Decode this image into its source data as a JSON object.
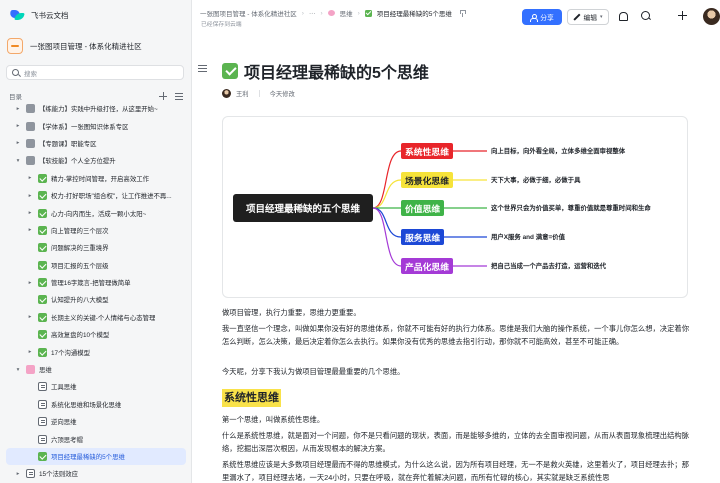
{
  "sidebar": {
    "brand": "飞书云文档",
    "workspace": "一张图项目管理 - 体系化精进社区",
    "search_placeholder": "搜索",
    "toc_title": "目录",
    "items": [
      {
        "arrow": "▸",
        "icon": "folder",
        "label": "【练能力】实践中升级打怪，从这里开始~",
        "indent": 1
      },
      {
        "arrow": "▸",
        "icon": "folder",
        "label": "【学体系】一张图知识体系专区",
        "indent": 1
      },
      {
        "arrow": "▸",
        "icon": "folder",
        "label": "【专题课】职能专区",
        "indent": 1
      },
      {
        "arrow": "▾",
        "icon": "folder",
        "label": "【软技能】个人全方位提升",
        "indent": 1
      },
      {
        "arrow": "▸",
        "icon": "check",
        "label": "精力-掌控时间管理，开启高效工作",
        "indent": 2
      },
      {
        "arrow": "▸",
        "icon": "check",
        "label": "权力-打好职场\"组合权\"，让工作推进不再...",
        "indent": 2
      },
      {
        "arrow": "▸",
        "icon": "check",
        "label": "心力-向内而生，活成一颗小太阳~",
        "indent": 2
      },
      {
        "arrow": "▸",
        "icon": "check",
        "label": "向上管理的三个层次",
        "indent": 2
      },
      {
        "arrow": "",
        "icon": "check",
        "label": "问题解决的三重境界",
        "indent": 2
      },
      {
        "arrow": "",
        "icon": "check",
        "label": "项目汇报的五个层级",
        "indent": 2
      },
      {
        "arrow": "▸",
        "icon": "check",
        "label": "管理16字箴言-把管理做简单",
        "indent": 2
      },
      {
        "arrow": "",
        "icon": "check",
        "label": "认知提升的八大模型",
        "indent": 2
      },
      {
        "arrow": "▸",
        "icon": "check",
        "label": "长期主义的关键-个人情绪与心态管理",
        "indent": 2
      },
      {
        "arrow": "",
        "icon": "check",
        "label": "高效复盘的10个模型",
        "indent": 2
      },
      {
        "arrow": "▸",
        "icon": "check",
        "label": "17个沟通模型",
        "indent": 2
      },
      {
        "arrow": "▾",
        "icon": "brain",
        "label": "思维",
        "indent": 1
      },
      {
        "arrow": "",
        "icon": "doc",
        "label": "工具思维",
        "indent": 2
      },
      {
        "arrow": "",
        "icon": "doc",
        "label": "系统化思维和场景化思维",
        "indent": 2
      },
      {
        "arrow": "",
        "icon": "doc",
        "label": "逆向思维",
        "indent": 2
      },
      {
        "arrow": "",
        "icon": "doc",
        "label": "六顶思考帽",
        "indent": 2
      },
      {
        "arrow": "",
        "icon": "check",
        "label": "项目经理最稀缺的5个思维",
        "indent": 2,
        "active": true
      },
      {
        "arrow": "▸",
        "icon": "doc",
        "label": "15个法则效应",
        "indent": 1
      }
    ]
  },
  "topbar": {
    "crumbs": [
      "一张图项目管理 - 体系化精进社区",
      "···",
      "思维",
      "项目经理最稀缺的5个思维"
    ],
    "saved": "已经保存到云端",
    "share_label": "分享",
    "edit_label": "编辑"
  },
  "doc": {
    "title": "项目经理最稀缺的5个思维",
    "author": "王利",
    "modified": "今天修改",
    "mindmap": {
      "root": "项目经理最稀缺的五个思维",
      "nodes": [
        {
          "label": "系统性思维",
          "desc": "向上目标，向外看全局，立体多维全面审视整体",
          "color": "#e8252a",
          "text": "#ffffff"
        },
        {
          "label": "场景化思维",
          "desc": "天下大事，必做于细，必做于具",
          "color": "#f6e33a",
          "text": "#1f2329"
        },
        {
          "label": "价值思维",
          "desc": "这个世界只会为价值买单，尊重价值就是尊重时间和生命",
          "color": "#3fb348",
          "text": "#ffffff"
        },
        {
          "label": "服务思维",
          "desc": "用户X服务 and 满意=价值",
          "color": "#1c48d6",
          "text": "#ffffff"
        },
        {
          "label": "产品化思维",
          "desc": "把自己当成一个产品去打造，运营和迭代",
          "color": "#a43ad6",
          "text": "#ffffff"
        }
      ]
    },
    "p1": "做项目管理，执行力重要，思维力更重要。",
    "p2": "我一直坚信一个理念，叫做如果你没有好的思维体系，你就不可能有好的执行力体系。思维是我们大脑的操作系统，一个事儿你怎么想，决定着你怎么判断，怎么决策，最后决定着你怎么去执行。如果你没有优秀的思维去指引行动，那你就不可能高效，甚至不可能正确。",
    "p3": "今天呢，分享下我认为做项目管理最最重要的几个思维。",
    "h2": "系统性思维",
    "p4": "第一个思维，叫做系统性思维。",
    "p5": "什么是系统性思维，就是面对一个问题，你不是只看问题的现状，表面，而是能够多维的，立体的去全面审视问题，从而从表面现象梳理出结构脉络，挖掘出深层次根因，从而发现根本的解决方案。",
    "p6": "系统性思维应该是大多数项目经理最而不得的思维模式，为什么这么说，因为所有项目经理，无一不是救火英雄，这里着火了，项目经理去扑；那里漏水了，项目经理去堵，一天24小时，只要在呼吸，就在奔忙着解决问题，而所有忙碌的核心，其实就是缺乏系统性思"
  }
}
